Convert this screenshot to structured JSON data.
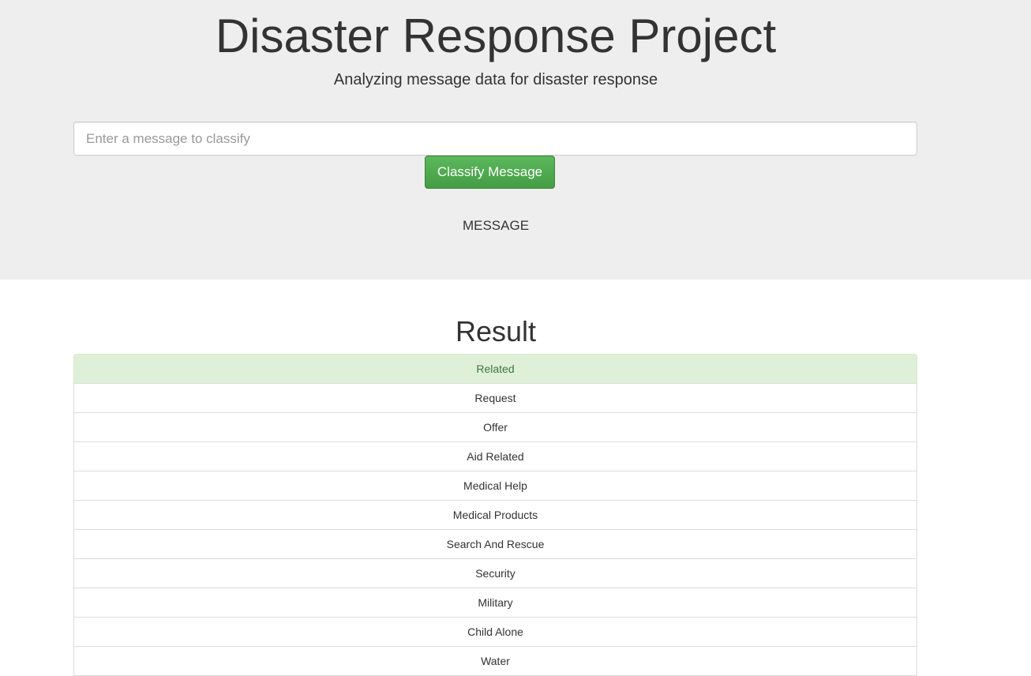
{
  "header": {
    "title": "Disaster Response Project",
    "subtitle": "Analyzing message data for disaster response"
  },
  "form": {
    "input_placeholder": "Enter a message to classify",
    "input_value": "",
    "button_label": "Classify Message",
    "message_label": "MESSAGE"
  },
  "colors": {
    "jumbotron_bg": "#eeeeee",
    "button_green": "#5cb85c",
    "success_bg": "#dff0d8",
    "success_text": "#3c763d"
  },
  "results": {
    "title": "Result",
    "categories": [
      {
        "label": "Related",
        "positive": true
      },
      {
        "label": "Request",
        "positive": false
      },
      {
        "label": "Offer",
        "positive": false
      },
      {
        "label": "Aid Related",
        "positive": false
      },
      {
        "label": "Medical Help",
        "positive": false
      },
      {
        "label": "Medical Products",
        "positive": false
      },
      {
        "label": "Search And Rescue",
        "positive": false
      },
      {
        "label": "Security",
        "positive": false
      },
      {
        "label": "Military",
        "positive": false
      },
      {
        "label": "Child Alone",
        "positive": false
      },
      {
        "label": "Water",
        "positive": false
      }
    ]
  }
}
